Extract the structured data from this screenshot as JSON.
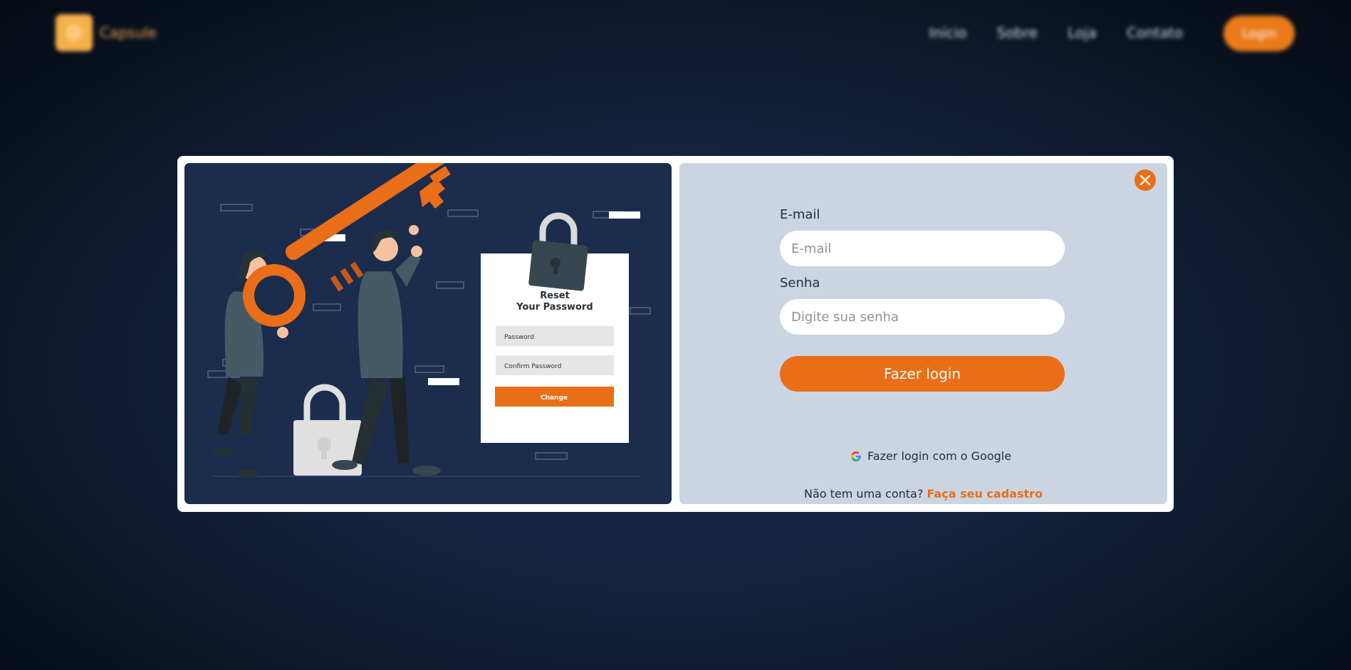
{
  "header": {
    "brand": "Capsule",
    "nav": [
      "Início",
      "Sobre",
      "Loja",
      "Contato"
    ],
    "login_label": "Login"
  },
  "modal": {
    "illustration": {
      "title_line1": "Reset",
      "title_line2": "Your Password",
      "field1": "Password",
      "field2": "Confirm Password",
      "button": "Change"
    },
    "form": {
      "email_label": "E-mail",
      "email_placeholder": "E-mail",
      "password_label": "Senha",
      "password_placeholder": "Digite sua senha",
      "submit_label": "Fazer login",
      "google_label": "Fazer login com o Google",
      "signup_prompt": "Não tem uma conta?",
      "signup_link": "Faça seu cadastro"
    }
  },
  "colors": {
    "accent": "#ea6e17",
    "panel_dark": "#1b2c4d",
    "panel_light": "#cbd5e1"
  }
}
